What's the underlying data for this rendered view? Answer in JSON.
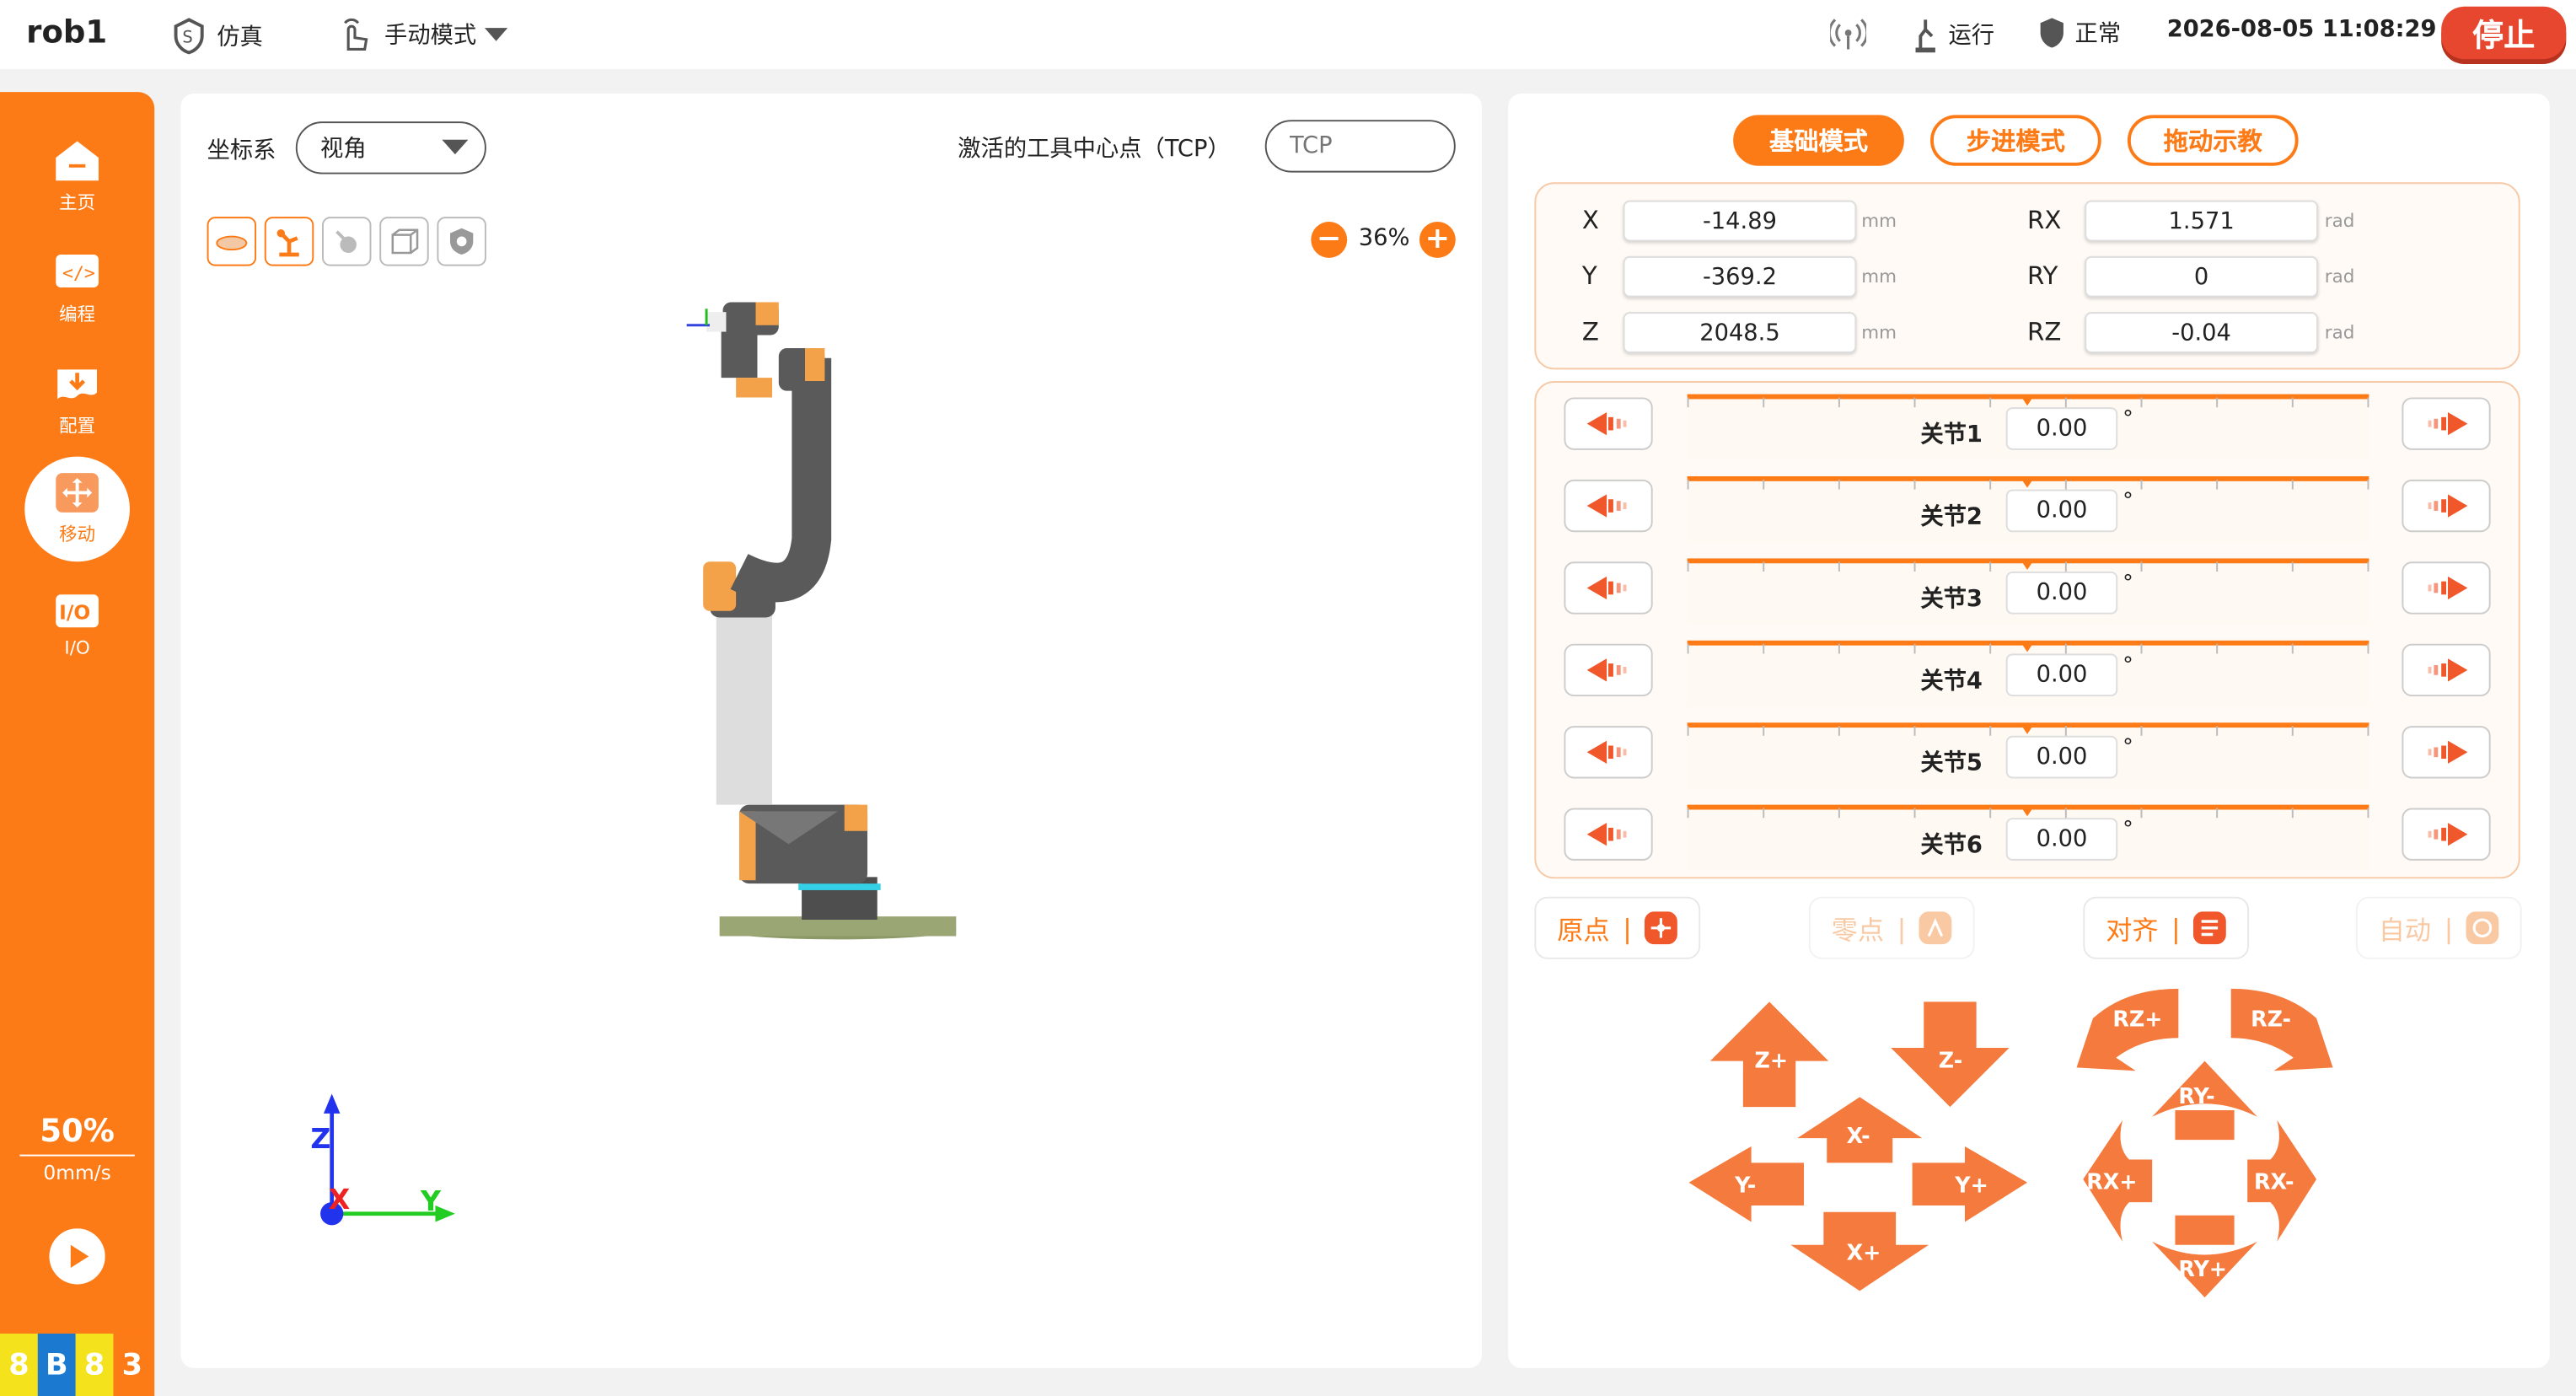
{
  "header": {
    "robot": "rob1",
    "sim_label": "仿真",
    "mode_label": "手动模式",
    "status_run": "运行",
    "status_ok": "正常",
    "datetime": "2026-08-05 11:08:29",
    "stop_label": "停止"
  },
  "sidebar": {
    "items": [
      {
        "label": "主页",
        "icon": "home-icon"
      },
      {
        "label": "编程",
        "icon": "code-icon"
      },
      {
        "label": "配置",
        "icon": "download-config-icon"
      },
      {
        "label": "移动",
        "icon": "move-icon"
      },
      {
        "label": "I/O",
        "icon": "io-icon"
      }
    ],
    "speed_percent": "50%",
    "speed_value": "0mm/s",
    "version": [
      "8",
      "B",
      "8",
      "3"
    ]
  },
  "view": {
    "coord_label": "坐标系",
    "coord_value": "视角",
    "tcp_label": "激活的工具中心点（TCP）",
    "tcp_placeholder": "TCP",
    "zoom": "36%",
    "axis_x": "X",
    "axis_y": "Y",
    "axis_z": "Z"
  },
  "modes": [
    "基础模式",
    "步进模式",
    "拖动示教"
  ],
  "coords": {
    "X": "-14.89",
    "Y": "-369.2",
    "Z": "2048.5",
    "RX": "1.571",
    "RY": "0",
    "RZ": "-0.04",
    "unit_mm": "mm",
    "unit_rad": "rad"
  },
  "joints": [
    {
      "label": "关节1",
      "value": "0.00"
    },
    {
      "label": "关节2",
      "value": "0.00"
    },
    {
      "label": "关节3",
      "value": "0.00"
    },
    {
      "label": "关节4",
      "value": "0.00"
    },
    {
      "label": "关节5",
      "value": "0.00"
    },
    {
      "label": "关节6",
      "value": "0.00"
    }
  ],
  "joint_unit": "°",
  "actions": [
    "原点",
    "零点",
    "对齐",
    "自动"
  ],
  "jog_linear": [
    "Z+",
    "Z-",
    "X-",
    "Y-",
    "Y+",
    "X+"
  ],
  "jog_rotation": [
    "RZ+",
    "RZ-",
    "RY-",
    "RX+",
    "RX-",
    "RY+"
  ],
  "colors": {
    "accent": "#fd7b17",
    "stop": "#e8472f",
    "jog_arrow": "#f57a3d"
  }
}
